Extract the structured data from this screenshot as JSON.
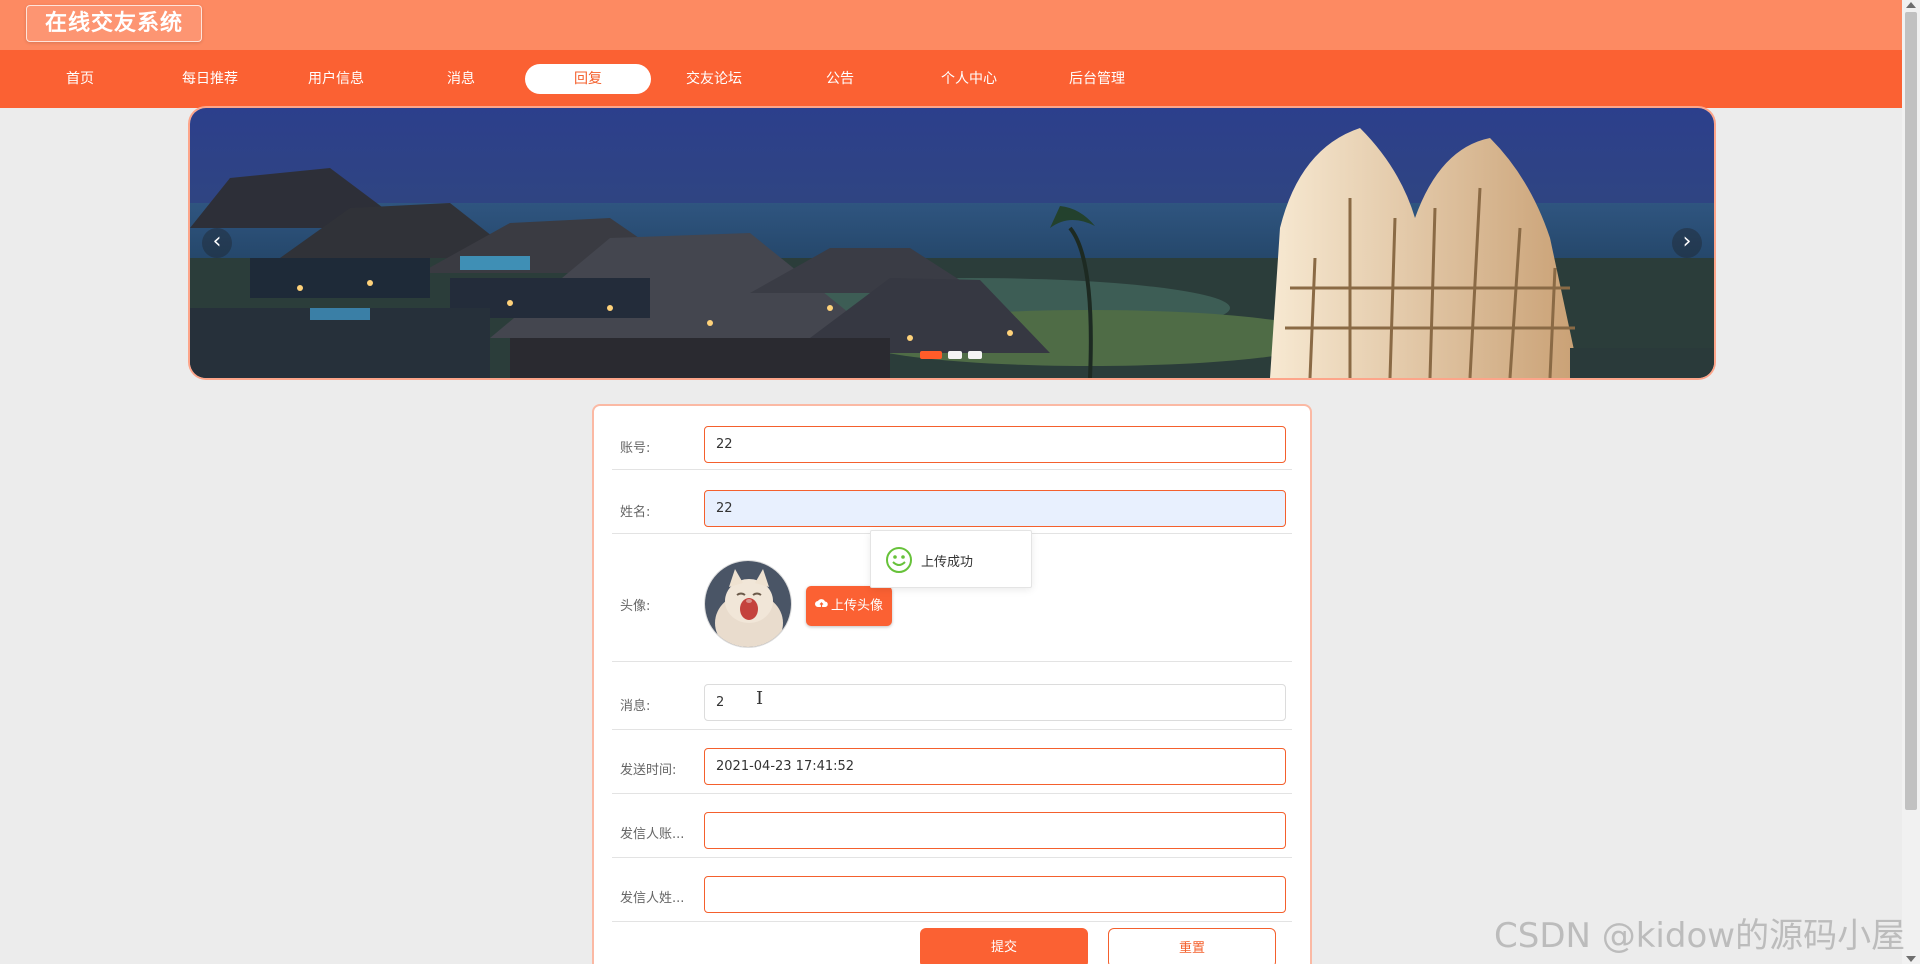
{
  "app": {
    "title": "在线交友系统"
  },
  "nav": {
    "items": [
      {
        "label": "首页"
      },
      {
        "label": "每日推荐"
      },
      {
        "label": "用户信息"
      },
      {
        "label": "消息"
      },
      {
        "label": "回复"
      },
      {
        "label": "交友论坛"
      },
      {
        "label": "公告"
      },
      {
        "label": "个人中心"
      },
      {
        "label": "后台管理"
      }
    ],
    "active_label": "回复"
  },
  "banner": {
    "prev_icon": "chevron-left-icon",
    "next_icon": "chevron-right-icon",
    "slide_count": 3,
    "active_slide": 1
  },
  "form": {
    "account": {
      "label": "账号:",
      "value": "22"
    },
    "name": {
      "label": "姓名:",
      "value": "22"
    },
    "avatar": {
      "label": "头像:",
      "upload_label": "上传头像",
      "upload_icon": "cloud-upload-icon"
    },
    "message": {
      "label": "消息:",
      "value": "2"
    },
    "send_time": {
      "label": "发送时间:",
      "value": "2021-04-23 17:41:52"
    },
    "sender_account": {
      "label": "发信人账...",
      "value": ""
    },
    "sender_name": {
      "label": "发信人姓...",
      "value": ""
    },
    "submit_label": "提交",
    "reset_label": "重置"
  },
  "toast": {
    "text": "上传成功",
    "icon": "smile-icon"
  },
  "watermark": {
    "text": "CSDN @kidow的源码小屋"
  },
  "colors": {
    "accent": "#fb6133",
    "header": "#fd8a62",
    "success": "#67c23a"
  }
}
